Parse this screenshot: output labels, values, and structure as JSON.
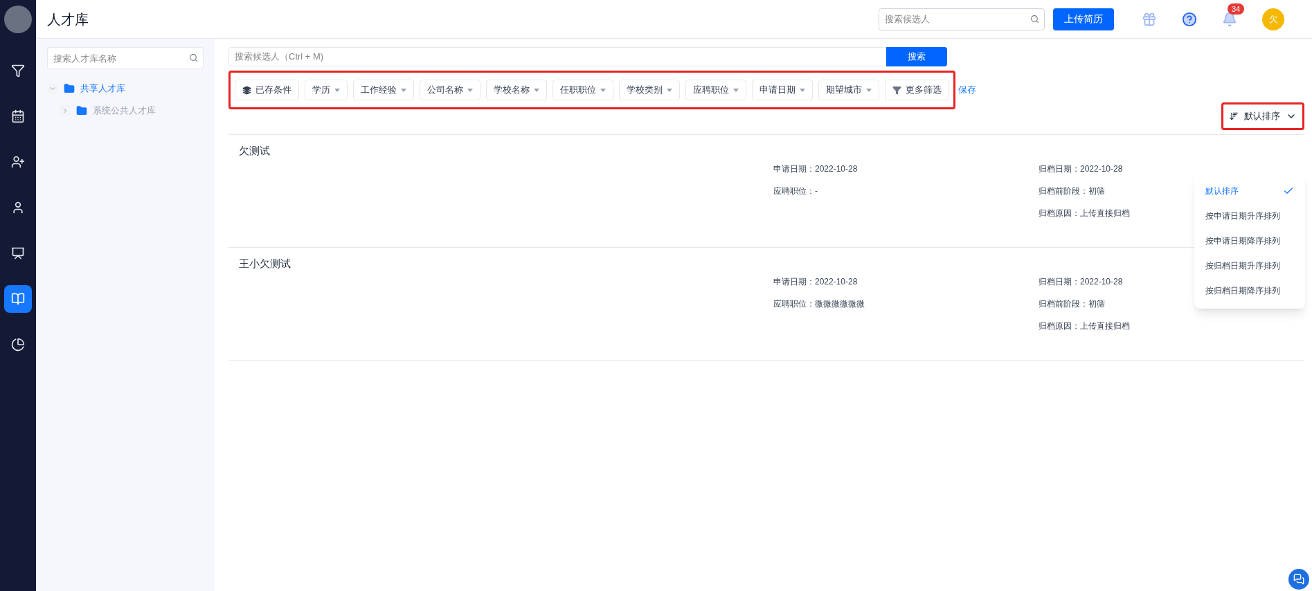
{
  "header": {
    "title": "人才库",
    "search": {
      "placeholder": "搜索候选人"
    },
    "upload_button": "上传简历",
    "notifications": {
      "count": "34"
    },
    "avatar": "欠"
  },
  "nav": [
    {
      "selected": false
    },
    {
      "selected": false
    },
    {
      "selected": false
    },
    {
      "selected": false
    },
    {
      "selected": false
    },
    {
      "selected": true
    },
    {
      "selected": false
    }
  ],
  "library_panel": {
    "search": {
      "placeholder": "搜索人才库名称"
    },
    "tree": [
      {
        "label": "共享人才库",
        "expanded": true,
        "selected": true,
        "children": [
          {
            "label": "系统公共人才库",
            "expanded": false,
            "disabled": true
          }
        ]
      }
    ]
  },
  "candidate_search": {
    "placeholder": "搜索候选人（Ctrl + M)",
    "button": "搜索"
  },
  "filters": [
    {
      "kind": "saved",
      "label": "已存条件"
    },
    {
      "kind": "dropdown",
      "label": "学历"
    },
    {
      "kind": "dropdown",
      "label": "工作经验"
    },
    {
      "kind": "dropdown",
      "label": "公司名称"
    },
    {
      "kind": "dropdown",
      "label": "学校名称"
    },
    {
      "kind": "dropdown",
      "label": "任职职位"
    },
    {
      "kind": "dropdown",
      "label": "学校类别"
    },
    {
      "kind": "dropdown",
      "label": "应聘职位"
    },
    {
      "kind": "dropdown",
      "label": "申请日期"
    },
    {
      "kind": "dropdown",
      "label": "期望城市"
    },
    {
      "kind": "more",
      "label": "更多筛选"
    }
  ],
  "save_link": "保存",
  "sort": {
    "label": "默认排序",
    "options": [
      {
        "label": "默认排序",
        "selected": true
      },
      {
        "label": "按申请日期升序排列",
        "selected": false
      },
      {
        "label": "按申请日期降序排列",
        "selected": false
      },
      {
        "label": "按归档日期升序排列",
        "selected": false
      },
      {
        "label": "按归档日期降序排列",
        "selected": false
      }
    ]
  },
  "candidates": [
    {
      "name": "欠测试",
      "left": [
        "申请日期：2022-10-28",
        "应聘职位：-"
      ],
      "right": [
        "归档日期：2022-10-28",
        "归档前阶段：初筛",
        "归档原因：上传直接归档"
      ]
    },
    {
      "name": "王小欠测试",
      "left": [
        "申请日期：2022-10-28",
        "应聘职位：微微微微微微"
      ],
      "right": [
        "归档日期：2022-10-28",
        "归档前阶段：初筛",
        "归档原因：上传直接归档"
      ]
    }
  ]
}
